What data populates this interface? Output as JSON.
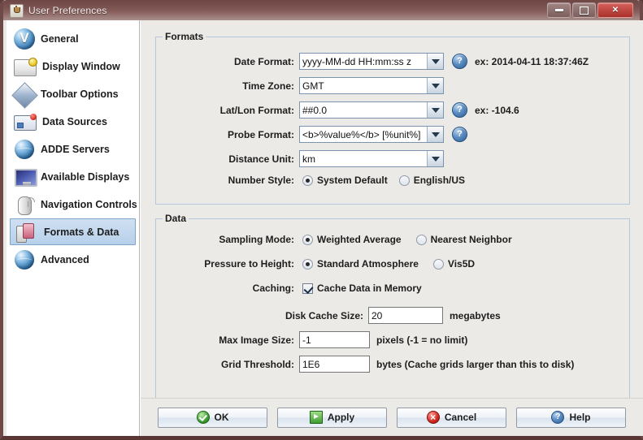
{
  "window": {
    "title": "User Preferences",
    "icon": "java-icon",
    "controls": [
      {
        "name": "minimize",
        "glyph": "minimize-icon"
      },
      {
        "name": "maximize",
        "glyph": "maximize-icon"
      },
      {
        "name": "close",
        "glyph": "close-icon",
        "color": "#c8352e"
      }
    ]
  },
  "sidebar": {
    "items": [
      {
        "label": "General",
        "icon": "globe-v-icon",
        "selected": false
      },
      {
        "label": "Display Window",
        "icon": "window-icon",
        "selected": false
      },
      {
        "label": "Toolbar Options",
        "icon": "diamond-icon",
        "selected": false
      },
      {
        "label": "Data Sources",
        "icon": "data-source-icon",
        "selected": false
      },
      {
        "label": "ADDE Servers",
        "icon": "globe-icon",
        "selected": false
      },
      {
        "label": "Available Displays",
        "icon": "monitor-icon",
        "selected": false
      },
      {
        "label": "Navigation Controls",
        "icon": "mouse-icon",
        "selected": false
      },
      {
        "label": "Formats & Data",
        "icon": "formats-icon",
        "selected": true
      },
      {
        "label": "Advanced",
        "icon": "globe-icon",
        "selected": false
      }
    ],
    "selected_color": "#bcd3ea"
  },
  "formats": {
    "title": "Formats",
    "date_format": {
      "label": "Date Format:",
      "value": "yyyy-MM-dd HH:mm:ss z",
      "help": "?",
      "example": "ex:  2014-04-11 18:37:46Z"
    },
    "time_zone": {
      "label": "Time Zone:",
      "value": "GMT"
    },
    "latlon_format": {
      "label": "Lat/Lon Format:",
      "value": "##0.0",
      "help": "?",
      "example": "ex: -104.6"
    },
    "probe_format": {
      "label": "Probe Format:",
      "value": "<b>%value%</b> [%unit%]",
      "help": "?"
    },
    "distance_unit": {
      "label": "Distance Unit:",
      "value": "km"
    },
    "number_style": {
      "label": "Number Style:",
      "options": [
        {
          "label": "System Default",
          "selected": true
        },
        {
          "label": "English/US",
          "selected": false
        }
      ]
    }
  },
  "data": {
    "title": "Data",
    "sampling_mode": {
      "label": "Sampling Mode:",
      "options": [
        {
          "label": "Weighted Average",
          "selected": true
        },
        {
          "label": "Nearest Neighbor",
          "selected": false
        }
      ]
    },
    "pressure_to_height": {
      "label": "Pressure to Height:",
      "options": [
        {
          "label": "Standard Atmosphere",
          "selected": true
        },
        {
          "label": "Vis5D",
          "selected": false
        }
      ]
    },
    "caching": {
      "label": "Caching:",
      "checkbox_label": "Cache Data in Memory",
      "checked": true
    },
    "disk_cache_size": {
      "label": "Disk Cache Size:",
      "value": "20",
      "unit": "megabytes"
    },
    "max_image_size": {
      "label": "Max Image Size:",
      "value": "-1",
      "unit": "pixels (-1 = no limit)"
    },
    "grid_threshold": {
      "label": "Grid Threshold:",
      "value": "1E6",
      "unit": "bytes (Cache grids larger than this to disk)"
    }
  },
  "buttons": [
    {
      "label": "OK",
      "icon": "ok-icon"
    },
    {
      "label": "Apply",
      "icon": "apply-icon"
    },
    {
      "label": "Cancel",
      "icon": "cancel-icon"
    },
    {
      "label": "Help",
      "icon": "help-icon"
    }
  ]
}
